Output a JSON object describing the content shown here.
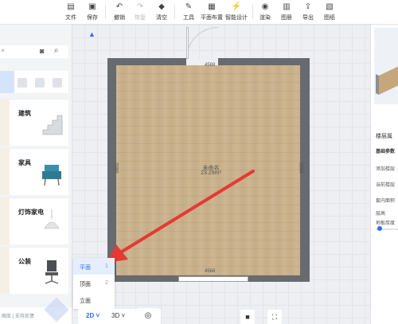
{
  "toolbar": {
    "file": "文件",
    "save": "保存",
    "undo": "撤销",
    "redo": "恢复",
    "clear": "清空",
    "tools": "工具",
    "floor_layout": "平面布置",
    "smart_design": "智能设计",
    "render": "渲染",
    "gallery": "图册",
    "export": "导出",
    "drawings": "图纸"
  },
  "left_panel": {
    "search_placeholder": "e",
    "categories": [
      "建筑",
      "家具",
      "灯饰家电",
      "公装"
    ],
    "footer": "图库 | 支持反馈"
  },
  "room": {
    "name": "未命名",
    "area": "23.29m²",
    "dim_top": "4568",
    "dim_bottom": "4568",
    "dim_left": "5096",
    "dim_right": "5096"
  },
  "view_menu": {
    "items": [
      {
        "label": "平面",
        "key": "1"
      },
      {
        "label": "顶面",
        "key": "2"
      },
      {
        "label": "立面",
        "key": ""
      }
    ]
  },
  "bottom_bar": {
    "mode_2d": "2D ˅",
    "mode_3d": "3D ˅"
  },
  "right_panel": {
    "title": "楼层属",
    "rows": [
      "基础参数",
      "添加楼层",
      "当前楼层",
      "套内面积",
      "层高",
      "地板厚度"
    ]
  },
  "colors": {
    "accent": "#2f6bf3",
    "wall": "#676a6e",
    "floor": "#cbb38d",
    "arrow": "#e53935"
  }
}
